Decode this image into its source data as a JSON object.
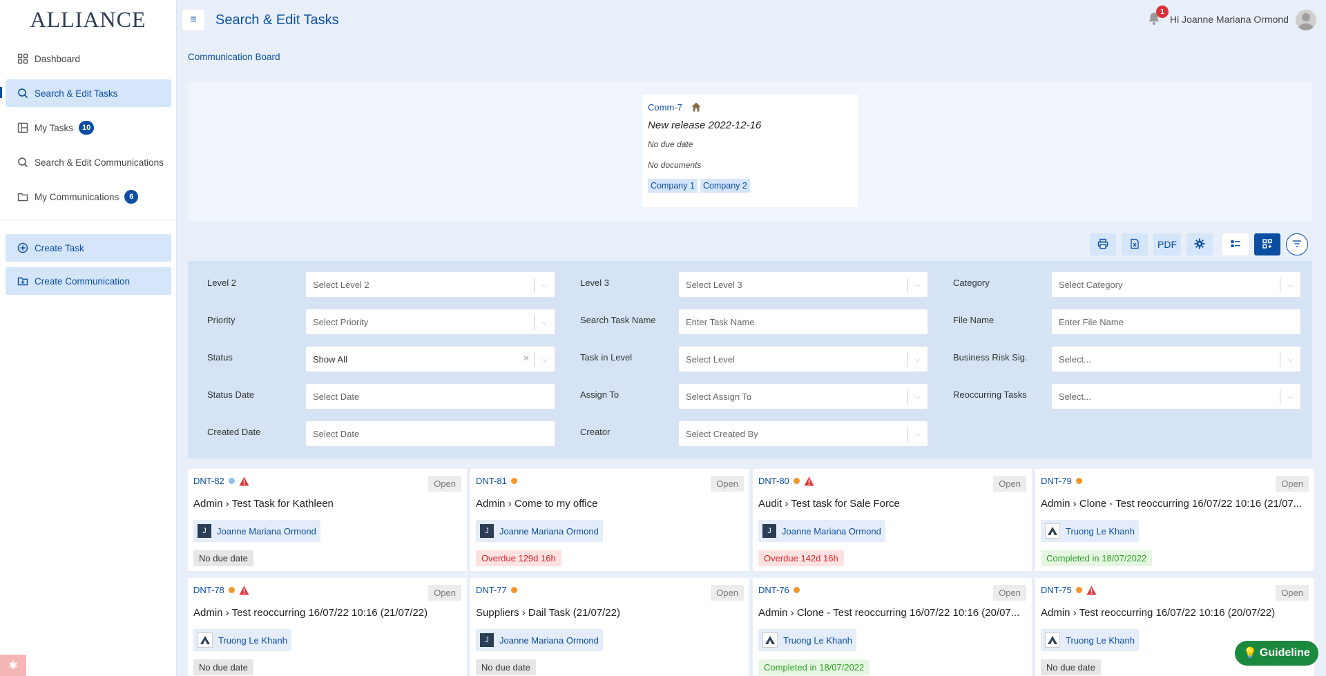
{
  "brand": {
    "logo_text": "ALLIANCE"
  },
  "sidebar": {
    "items": [
      {
        "label": "Dashboard",
        "icon": "grid-icon"
      },
      {
        "label": "Search & Edit Tasks",
        "icon": "search-icon",
        "active": true
      },
      {
        "label": "My Tasks",
        "icon": "layout-icon",
        "badge": "10"
      },
      {
        "label": "Search & Edit Communications",
        "icon": "search-icon"
      },
      {
        "label": "My Communications",
        "icon": "folder-icon",
        "badge": "6"
      }
    ],
    "actions": [
      {
        "label": "Create Task",
        "icon": "plus-circle-icon"
      },
      {
        "label": "Create Communication",
        "icon": "folder-plus-icon"
      }
    ]
  },
  "header": {
    "title": "Search & Edit Tasks",
    "notification_count": "1",
    "greeting": "Hi Joanne Mariana Ormond"
  },
  "breadcrumb": {
    "label": "Communication Board"
  },
  "communication": {
    "id": "Comm-7",
    "title": "New release 2022-12-16",
    "due": "No due date",
    "documents": "No documents",
    "tags": [
      "Company 1",
      "Company 2"
    ]
  },
  "toolbar": {
    "print_icon": "printer-icon",
    "excel_icon": "excel-icon",
    "pdf_label": "PDF",
    "settings_icon": "gear-icon",
    "list_icon": "list-view-icon",
    "grid_icon": "grid-view-icon",
    "filter_icon": "filter-icon"
  },
  "filters": {
    "level2": {
      "label": "Level 2",
      "placeholder": "Select Level 2"
    },
    "level3": {
      "label": "Level 3",
      "placeholder": "Select Level 3"
    },
    "category": {
      "label": "Category",
      "placeholder": "Select Category"
    },
    "priority": {
      "label": "Priority",
      "placeholder": "Select Priority"
    },
    "task_name": {
      "label": "Search Task Name",
      "placeholder": "Enter Task Name"
    },
    "file_name": {
      "label": "File Name",
      "placeholder": "Enter File Name"
    },
    "status": {
      "label": "Status",
      "value": "Show All"
    },
    "task_in_level": {
      "label": "Task in Level",
      "placeholder": "Select Level"
    },
    "business_risk": {
      "label": "Business Risk Sig.",
      "placeholder": "Select..."
    },
    "status_date": {
      "label": "Status Date",
      "placeholder": "Select Date"
    },
    "assign_to": {
      "label": "Assign To",
      "placeholder": "Select Assign To"
    },
    "reoccurring": {
      "label": "Reoccurring Tasks",
      "placeholder": "Select..."
    },
    "created_date": {
      "label": "Created Date",
      "placeholder": "Select Date"
    },
    "creator": {
      "label": "Creator",
      "placeholder": "Select Created By"
    }
  },
  "colors": {
    "accent": "#0b4ea2",
    "dot_blue": "#8fc1f0",
    "dot_orange": "#f2962a",
    "warn_red": "#e23b3b"
  },
  "tasks": [
    {
      "id": "DNT-82",
      "dot": "blue",
      "warn": true,
      "status": "Open",
      "title": "Admin › Test Task for Kathleen",
      "assignee": "Joanne Mariana Ormond",
      "avatar": "J",
      "due": "No due date",
      "due_type": "none"
    },
    {
      "id": "DNT-81",
      "dot": "orange",
      "warn": false,
      "status": "Open",
      "title": "Admin › Come to my office",
      "assignee": "Joanne Mariana Ormond",
      "avatar": "J",
      "due": "Overdue 129d 16h",
      "due_type": "over"
    },
    {
      "id": "DNT-80",
      "dot": "orange",
      "warn": true,
      "status": "Open",
      "title": "Audit › Test task for Sale Force",
      "assignee": "Joanne Mariana Ormond",
      "avatar": "J",
      "due": "Overdue 142d 16h",
      "due_type": "over"
    },
    {
      "id": "DNT-79",
      "dot": "orange",
      "warn": false,
      "status": "Open",
      "title": "Admin › Clone - Test reoccurring 16/07/22 10:16 (21/07...",
      "assignee": "Truong Le Khanh",
      "avatar": "logo",
      "due": "Completed in 18/07/2022",
      "due_type": "done"
    },
    {
      "id": "DNT-78",
      "dot": "orange",
      "warn": true,
      "status": "Open",
      "title": "Admin › Test reoccurring 16/07/22 10:16 (21/07/22)",
      "assignee": "Truong Le Khanh",
      "avatar": "logo",
      "due": "No due date",
      "due_type": "none"
    },
    {
      "id": "DNT-77",
      "dot": "orange",
      "warn": false,
      "status": "Open",
      "title": "Suppliers › Dail Task (21/07/22)",
      "assignee": "Joanne Mariana Ormond",
      "avatar": "J",
      "due": "No due date",
      "due_type": "none"
    },
    {
      "id": "DNT-76",
      "dot": "orange",
      "warn": false,
      "status": "Open",
      "title": "Admin › Clone - Test reoccurring 16/07/22 10:16 (20/07...",
      "assignee": "Truong Le Khanh",
      "avatar": "logo",
      "due": "Completed in 18/07/2022",
      "due_type": "done"
    },
    {
      "id": "DNT-75",
      "dot": "orange",
      "warn": true,
      "status": "Open",
      "title": "Admin › Test reoccurring 16/07/22 10:16 (20/07/22)",
      "assignee": "Truong Le Khanh",
      "avatar": "logo",
      "due": "No due date",
      "due_type": "none"
    }
  ],
  "guideline": {
    "label": "Guideline"
  }
}
